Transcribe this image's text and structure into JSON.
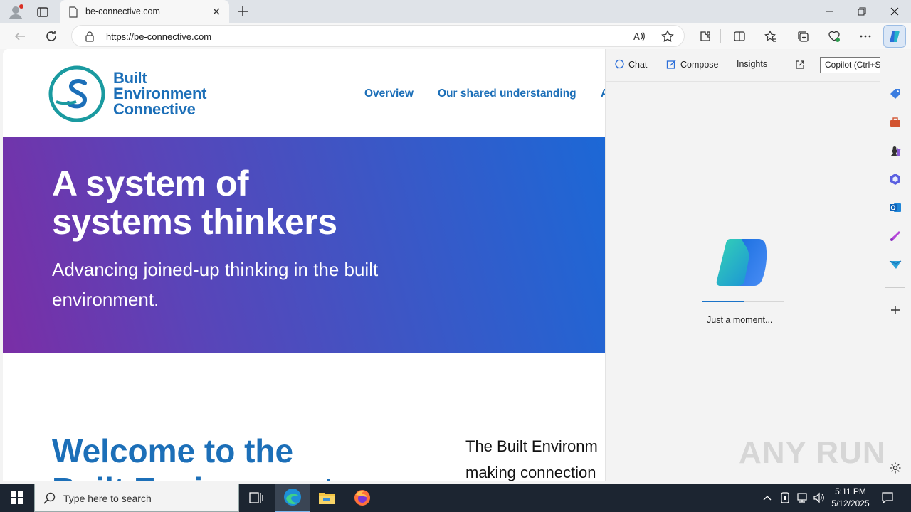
{
  "browser": {
    "tab_title": "be-connective.com",
    "url": "https://be-connective.com",
    "tooltip": "Copilot (Ctrl+Shift+.)"
  },
  "site": {
    "logo_line1": "Built",
    "logo_line2": "Environment",
    "logo_line3": "Connective",
    "nav": [
      "Overview",
      "Our shared understanding",
      "A"
    ],
    "hero_title_line1": "A system of",
    "hero_title_line2": "systems thinkers",
    "hero_subtitle": "Advancing joined-up thinking in the built environment.",
    "welcome_line1": "Welcome to the",
    "welcome_line2": "Built Environment",
    "intro_line1": "The Built Environm",
    "intro_line2": "making connection"
  },
  "copilot": {
    "tabs": [
      "Chat",
      "Compose",
      "Insights"
    ],
    "loading_text": "Just a moment...",
    "progress": 0.5
  },
  "taskbar": {
    "search_placeholder": "Type here to search",
    "time": "5:11 PM",
    "date": "5/12/2025"
  },
  "watermark": "ANY RUN",
  "colors": {
    "brand_blue": "#1c6fb8",
    "logo_teal": "#1a9aa0",
    "hero_start": "#7a2ea6",
    "hero_end": "#1c68d6"
  }
}
